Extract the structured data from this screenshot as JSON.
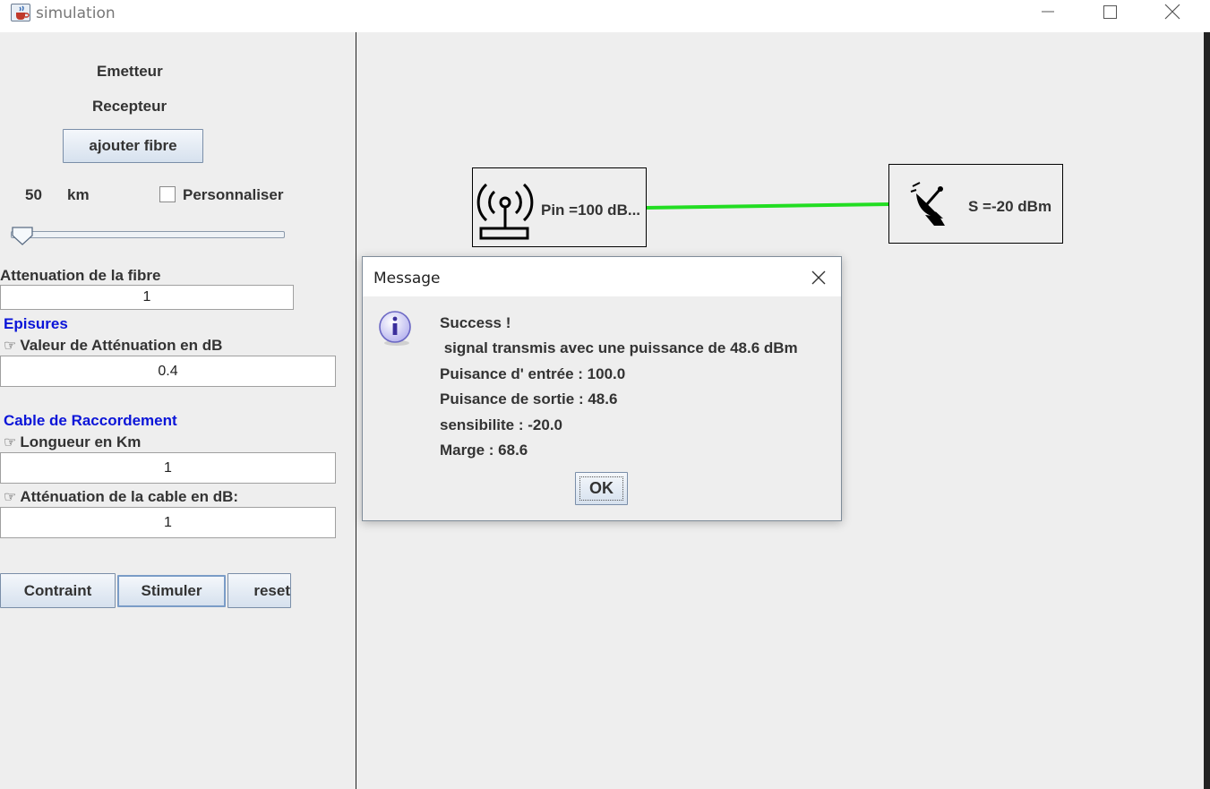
{
  "window": {
    "title": "simulation"
  },
  "left": {
    "emetteur": "Emetteur",
    "recepteur": "Recepteur",
    "add_fiber": "ajouter fibre",
    "distance_value": "50",
    "distance_unit": "km",
    "custom_label": "Personnaliser",
    "custom_checked": false,
    "slider_fraction": 0.0,
    "fiber_att_label": "Attenuation de la fibre",
    "fiber_att_value": "1",
    "splices_heading": "Episures",
    "splice_att_label": "Valeur de Atténuation en dB",
    "splice_att_value": "0.4",
    "cable_heading": "Cable de Raccordement",
    "cable_len_label": "Longueur en Km",
    "cable_len_value": "1",
    "cable_att_label": "Atténuation de la cable en dB:",
    "cable_att_value": "1",
    "btn_contraint": "Contraint",
    "btn_stimuler": "Stimuler",
    "btn_reset": "reset"
  },
  "canvas": {
    "emitter_label": "Pin =100 dB...",
    "receiver_label": "S =-20 dBm",
    "link_color": "#22dd22"
  },
  "dialog": {
    "title": "Message",
    "line1": "Success !",
    "line2": " signal transmis avec une puissance de 48.6 dBm",
    "line3": "Puisance d' entrée : 100.0",
    "line4": "Puisance de sortie : 48.6",
    "line5": "sensibilite : -20.0",
    "line6": "Marge : 68.6",
    "ok": "OK"
  },
  "icons": {
    "app": "java-cup-icon",
    "emitter": "antenna-tower-icon",
    "receiver": "satellite-dish-icon",
    "info": "info-icon",
    "hand": "pointing-hand-icon"
  }
}
